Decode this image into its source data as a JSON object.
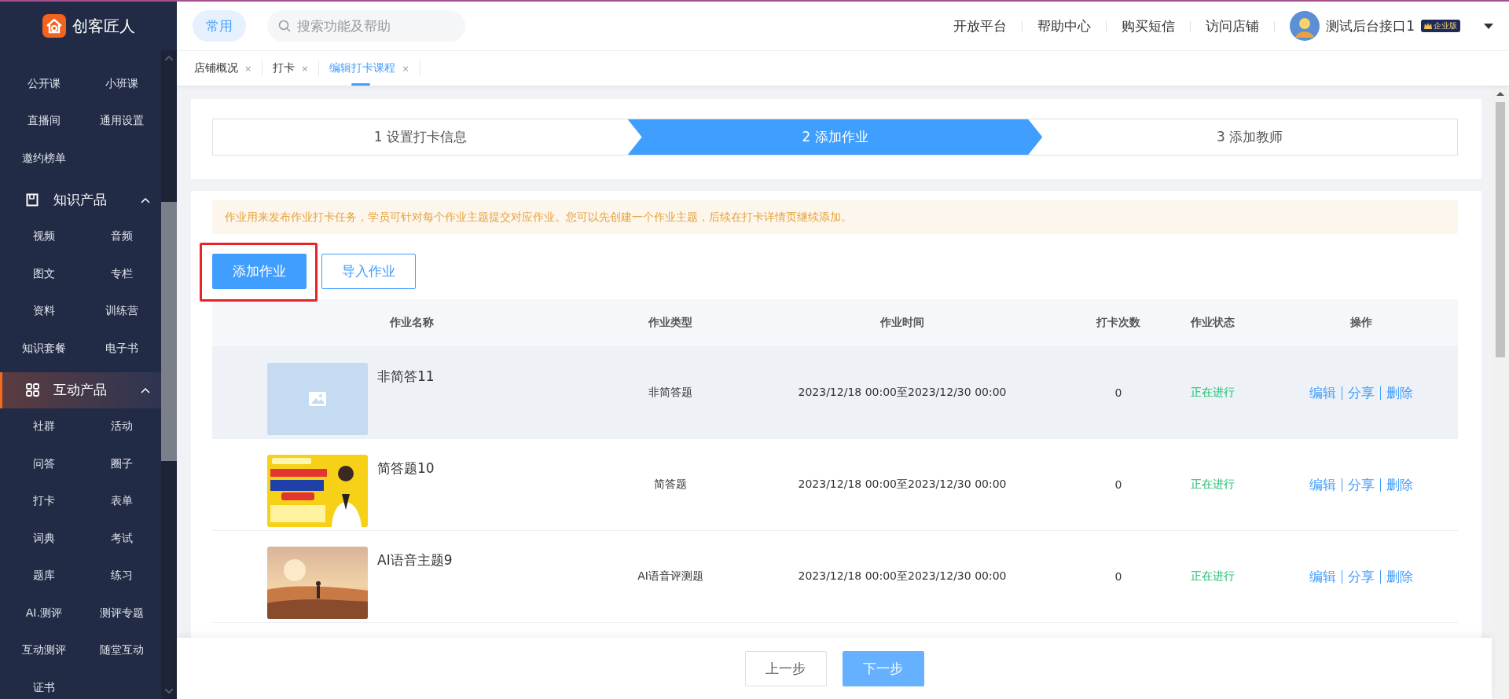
{
  "sidebar": {
    "logo": "创客匠人",
    "groups": [
      {
        "items": [
          "公开课",
          "小班课",
          "直播间",
          "通用设置",
          "邀约榜单"
        ]
      },
      {
        "label": "知识产品",
        "expanded": true,
        "selected": false,
        "items": [
          "视频",
          "音频",
          "图文",
          "专栏",
          "资料",
          "训练营",
          "知识套餐",
          "电子书"
        ]
      },
      {
        "label": "互动产品",
        "expanded": true,
        "selected": true,
        "items": [
          "社群",
          "活动",
          "问答",
          "圈子",
          "打卡",
          "表单",
          "词典",
          "考试",
          "题库",
          "练习",
          "AI.测评",
          "测评专题",
          "互动测评",
          "随堂互动",
          "证书"
        ]
      }
    ]
  },
  "header": {
    "quick_button": "常用",
    "search": {
      "placeholder": "搜索功能及帮助"
    },
    "links": [
      "开放平台",
      "帮助中心",
      "购买短信",
      "访问店铺"
    ],
    "user": {
      "name": "测试后台接口1",
      "badge": "企业版"
    }
  },
  "tabs": [
    {
      "label": "店铺概况",
      "close": "×",
      "selected": false
    },
    {
      "label": "打卡",
      "close": "×",
      "selected": false
    },
    {
      "label": "编辑打卡课程",
      "close": "×",
      "selected": true
    }
  ],
  "steps": [
    {
      "label": "1 设置打卡信息",
      "selected": false
    },
    {
      "label": "2 添加作业",
      "selected": true
    },
    {
      "label": "3 添加教师",
      "selected": false
    }
  ],
  "notice": "作业用来发布作业打卡任务，学员可针对每个作业主题提交对应作业。您可以先创建一个作业主题，后续在打卡详情页继续添加。",
  "buttons": [
    {
      "label": "添加作业",
      "kind": "primary",
      "highlighted": true
    },
    {
      "label": "导入作业",
      "kind": "outline"
    }
  ],
  "table": {
    "columns": [
      "作业名称",
      "作业类型",
      "作业时间",
      "打卡次数",
      "作业状态",
      "操作"
    ],
    "rows": [
      {
        "kind": "placeholder",
        "title": "非简答11",
        "type": "非简答题",
        "time": "2023/12/18 00:00至2023/12/30 00:00",
        "count": "0",
        "status": "正在进行",
        "actions": [
          "编辑",
          "分享",
          "删除"
        ],
        "hovered": true
      },
      {
        "kind": "picture",
        "title": "简答题10",
        "type": "简答题",
        "time": "2023/12/18 00:00至2023/12/30 00:00",
        "count": "0",
        "status": "正在进行",
        "actions": [
          "编辑",
          "分享",
          "删除"
        ],
        "hovered": false
      },
      {
        "kind": "picture",
        "title": "AI语音主题9",
        "type": "AI语音评测题",
        "time": "2023/12/18 00:00至2023/12/30 00:00",
        "count": "0",
        "status": "正在进行",
        "actions": [
          "编辑",
          "分享",
          "删除"
        ],
        "hovered": false
      }
    ]
  },
  "footer": {
    "buttons": [
      {
        "label": "上一步",
        "kind": "outline"
      },
      {
        "label": "下一步",
        "kind": "primary"
      }
    ]
  }
}
